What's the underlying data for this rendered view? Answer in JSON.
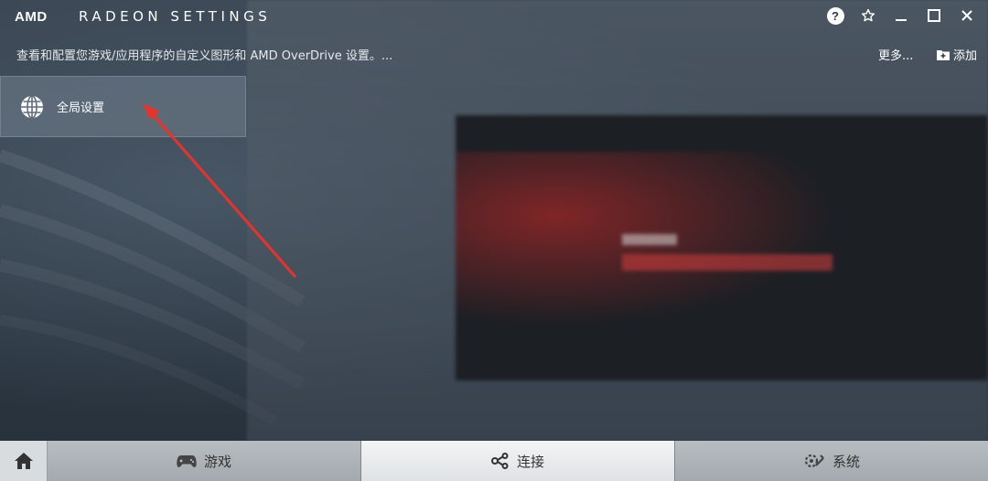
{
  "window": {
    "brand": "AMD",
    "title": "RADEON SETTINGS"
  },
  "subheader": {
    "description": "查看和配置您游戏/应用程序的自定义图形和 AMD OverDrive 设置。...",
    "more_label": "更多...",
    "add_label": "添加"
  },
  "tiles": {
    "global_settings_label": "全局设置"
  },
  "bottom_nav": {
    "tabs": [
      {
        "label": "游戏",
        "icon": "gamepad-icon"
      },
      {
        "label": "连接",
        "icon": "connect-icon"
      },
      {
        "label": "系统",
        "icon": "wrench-gear-icon"
      }
    ],
    "active_tab": "连接"
  },
  "colors": {
    "annotation_arrow": "#e8322c",
    "nav_active": "#eeeff0"
  },
  "icons": {
    "help": "help-icon",
    "favorite": "star-icon",
    "minimize": "minimize-icon",
    "maximize": "maximize-icon",
    "close": "close-icon",
    "home": "home-icon",
    "global": "globe-icon"
  }
}
